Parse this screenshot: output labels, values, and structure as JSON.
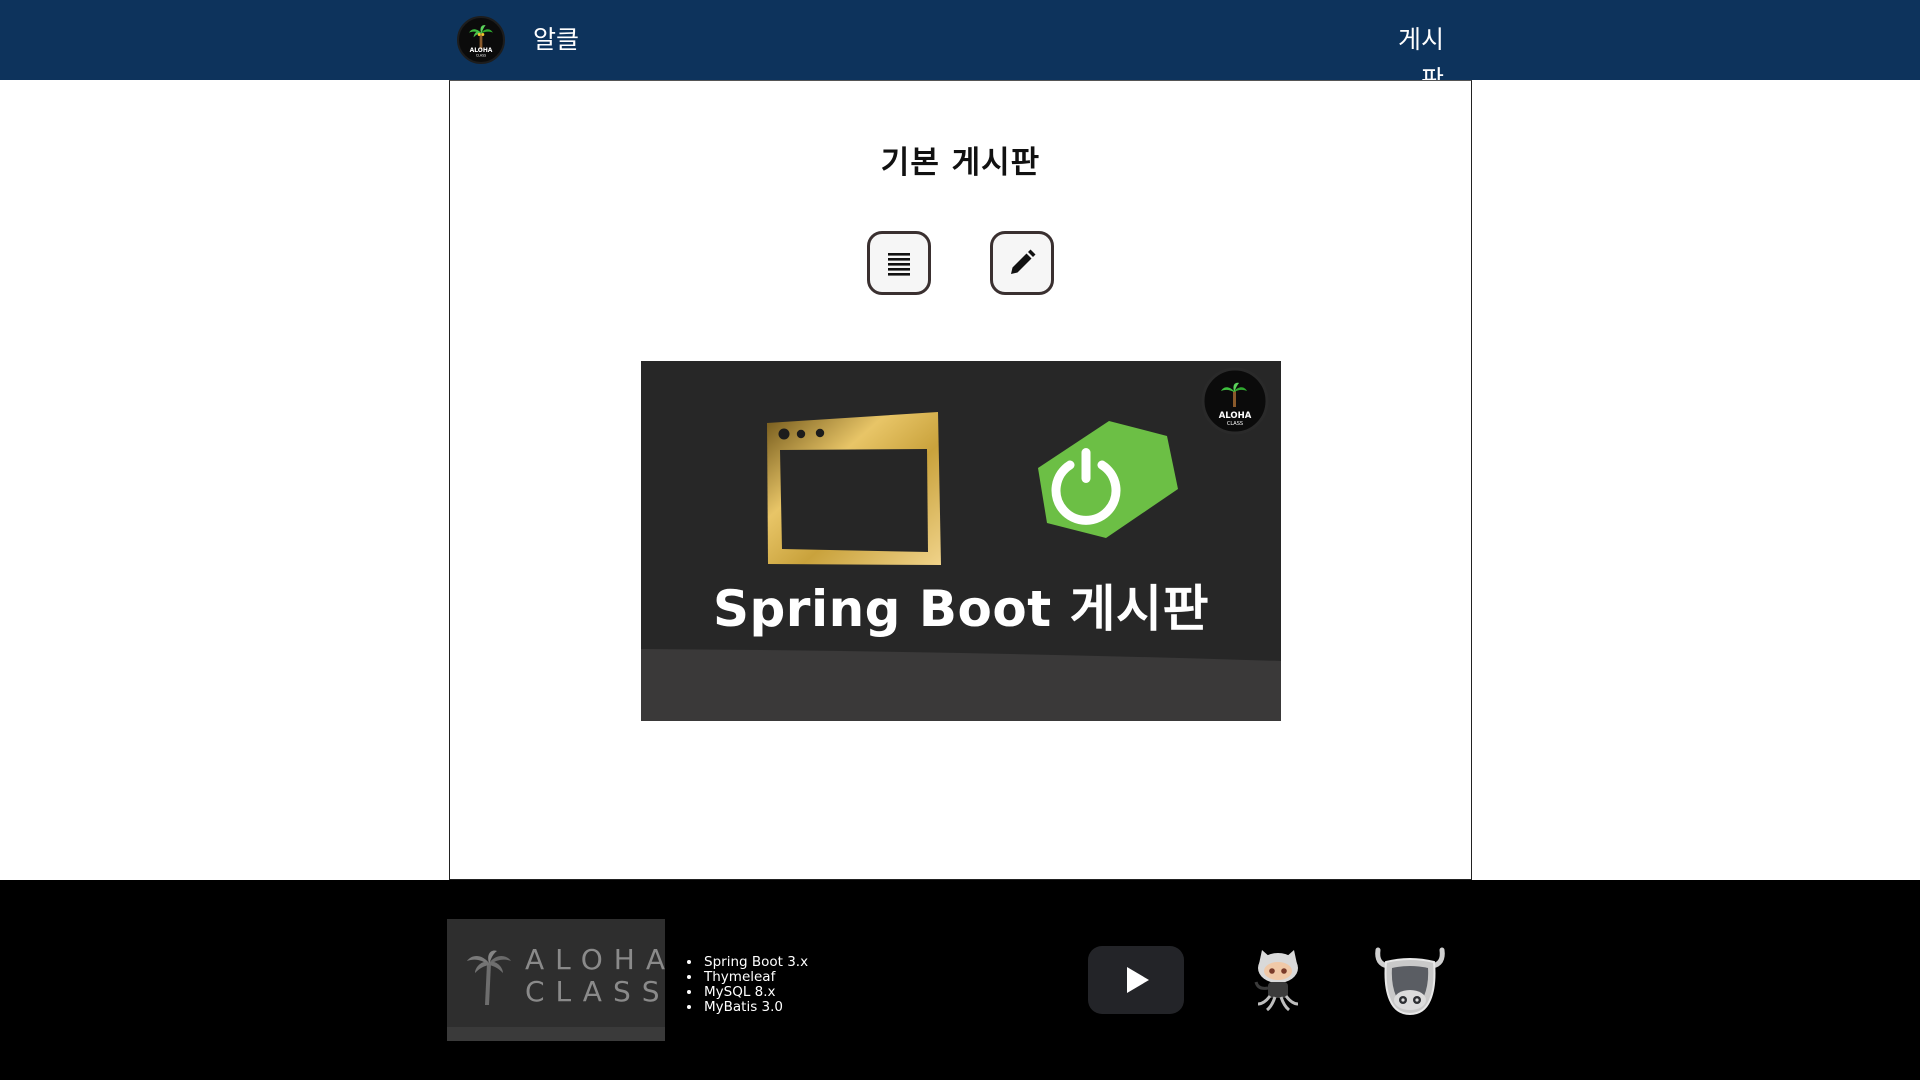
{
  "header": {
    "logo_text_top": "ALOHA",
    "logo_text_bottom": "CLASS",
    "brand_name": "알클",
    "nav_board": "게시판"
  },
  "main": {
    "title": "기본 게시판",
    "buttons": [
      {
        "icon": "list-icon"
      },
      {
        "icon": "pencil-icon"
      }
    ],
    "banner": {
      "title": "Spring Boot 게시판",
      "badge_text_top": "ALOHA",
      "badge_text_bottom": "CLASS"
    }
  },
  "footer": {
    "logo_line1": "ALOHA",
    "logo_line2": "CLASS",
    "stack": [
      "Spring Boot 3.x",
      "Thymeleaf",
      "MySQL 8.x",
      "MyBatis 3.0"
    ],
    "social": [
      "youtube-icon",
      "github-icon",
      "cow-icon"
    ]
  },
  "colors": {
    "header_bg": "#0d335c",
    "footer_bg": "#000000",
    "banner_bg": "#272727",
    "spring_green": "#6cbf45",
    "gold": "#c9a23c"
  }
}
